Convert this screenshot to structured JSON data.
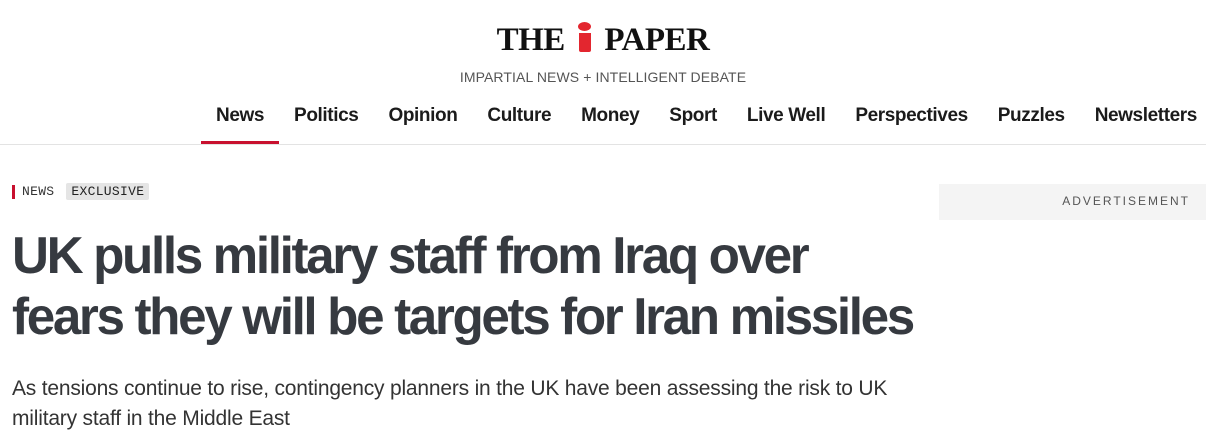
{
  "masthead": {
    "logo_left": "THE",
    "logo_right": "PAPER",
    "logo_icon": "i-logo-icon",
    "tagline": "IMPARTIAL NEWS + INTELLIGENT DEBATE"
  },
  "nav": {
    "items": [
      {
        "label": "News",
        "active": true
      },
      {
        "label": "Politics"
      },
      {
        "label": "Opinion"
      },
      {
        "label": "Culture"
      },
      {
        "label": "Money"
      },
      {
        "label": "Sport"
      },
      {
        "label": "Live Well"
      },
      {
        "label": "Perspectives"
      },
      {
        "label": "Puzzles"
      },
      {
        "label": "Newsletters"
      }
    ]
  },
  "article": {
    "section": "NEWS",
    "badge": "EXCLUSIVE",
    "headline": "UK pulls military staff from Iraq over fears they will be targets for Iran missiles",
    "standfirst": "As tensions continue to rise, contingency planners in the UK have been assessing the risk to UK military staff in the Middle East"
  },
  "sidebar": {
    "ad_label": "ADVERTISEMENT"
  },
  "colors": {
    "accent": "#c8102e",
    "logo_red": "#e3262f",
    "headline": "#363a40"
  }
}
